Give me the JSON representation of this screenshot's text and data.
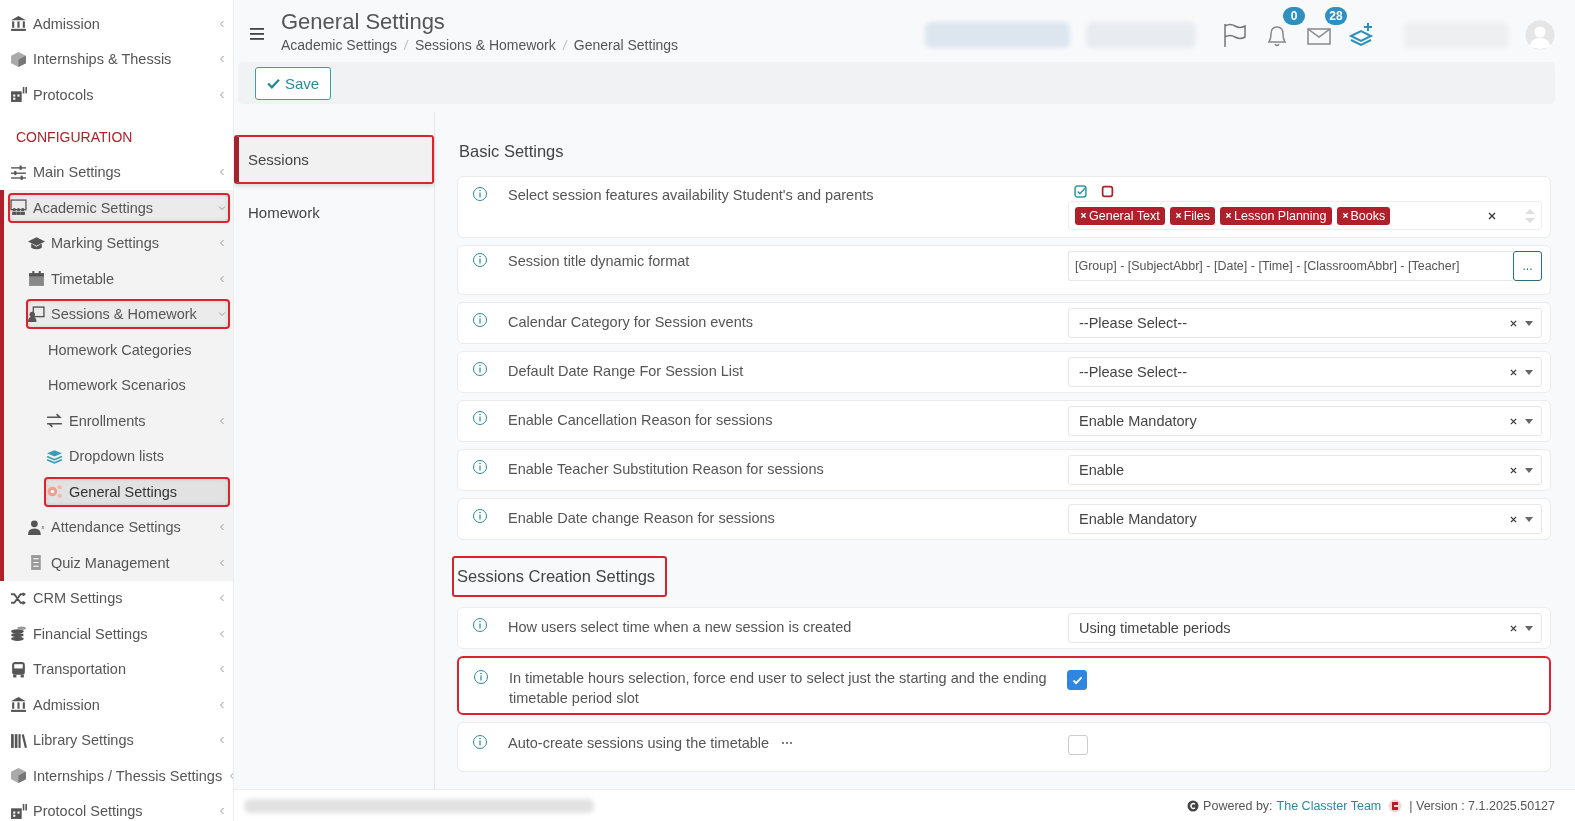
{
  "sidebar": {
    "items": [
      {
        "kind": "link",
        "label": "Admission",
        "expanded": false,
        "selected": false,
        "highlighted": false
      },
      {
        "kind": "link",
        "label": "Internships & Thessis",
        "expanded": false,
        "selected": false,
        "highlighted": false
      },
      {
        "kind": "link",
        "label": "Protocols",
        "expanded": false,
        "selected": false,
        "highlighted": false
      },
      {
        "kind": "heading",
        "label": "CONFIGURATION"
      },
      {
        "kind": "link",
        "label": "Main Settings",
        "expanded": false,
        "selected": false,
        "highlighted": false
      },
      {
        "kind": "link",
        "label": "Academic Settings",
        "expanded": true,
        "selected": false,
        "highlighted": true,
        "children": [
          {
            "kind": "link",
            "label": "Marking Settings",
            "expanded": false,
            "selected": false,
            "highlighted": false
          },
          {
            "kind": "link",
            "label": "Timetable",
            "expanded": false,
            "selected": false,
            "highlighted": false
          },
          {
            "kind": "link",
            "label": "Sessions & Homework",
            "expanded": true,
            "selected": false,
            "highlighted": true,
            "children": [
              {
                "kind": "link",
                "label": "Homework Categories",
                "selected": false,
                "highlighted": false
              },
              {
                "kind": "link",
                "label": "Homework Scenarios",
                "selected": false,
                "highlighted": false
              },
              {
                "kind": "link",
                "label": "Enrollments",
                "expanded": false,
                "selected": false,
                "highlighted": false
              },
              {
                "kind": "link",
                "label": "Dropdown lists",
                "selected": false,
                "highlighted": false
              },
              {
                "kind": "link",
                "label": "General Settings",
                "selected": true,
                "highlighted": true
              }
            ]
          },
          {
            "kind": "link",
            "label": "Attendance Settings",
            "expanded": false,
            "selected": false,
            "highlighted": false
          },
          {
            "kind": "link",
            "label": "Quiz Management",
            "expanded": false,
            "selected": false,
            "highlighted": false
          }
        ]
      },
      {
        "kind": "link",
        "label": "CRM Settings",
        "expanded": false,
        "selected": false,
        "highlighted": false
      },
      {
        "kind": "link",
        "label": "Financial Settings",
        "expanded": false,
        "selected": false,
        "highlighted": false
      },
      {
        "kind": "link",
        "label": "Transportation",
        "expanded": false,
        "selected": false,
        "highlighted": false
      },
      {
        "kind": "link",
        "label": "Admission",
        "expanded": false,
        "selected": false,
        "highlighted": false
      },
      {
        "kind": "link",
        "label": "Library Settings",
        "expanded": false,
        "selected": false,
        "highlighted": false
      },
      {
        "kind": "link",
        "label": "Internships / Thessis Settings",
        "expanded": false,
        "selected": false,
        "highlighted": false
      },
      {
        "kind": "link",
        "label": "Protocol Settings",
        "expanded": false,
        "selected": false,
        "highlighted": false
      }
    ]
  },
  "header": {
    "title": "General Settings",
    "breadcrumb": [
      "Academic Settings",
      "Sessions & Homework",
      "General Settings"
    ],
    "notifications": "0",
    "messages": "28"
  },
  "toolbar": {
    "save": "Save"
  },
  "tabs": [
    {
      "label": "Sessions",
      "selected": true,
      "highlighted": true
    },
    {
      "label": "Homework",
      "selected": false,
      "highlighted": false
    }
  ],
  "sections": [
    {
      "title": "Basic Settings",
      "highlighted": false,
      "rows": [
        {
          "kind": "tags",
          "label": "Select session features availability Student's and parents",
          "tags": [
            "General Text",
            "Files",
            "Lesson Planning",
            "Books"
          ],
          "highlighted": false
        },
        {
          "kind": "format",
          "label": "Session title dynamic format",
          "value": "[Group] - [SubjectAbbr] - [Date] - [Time] - [ClassroomAbbr] - [Teacher]",
          "button": "...",
          "highlighted": false
        },
        {
          "kind": "select",
          "label": "Calendar Category for Session events",
          "value": "--Please Select--",
          "highlighted": false
        },
        {
          "kind": "select",
          "label": "Default Date Range For Session List",
          "value": "--Please Select--",
          "highlighted": false
        },
        {
          "kind": "select",
          "label": "Enable Cancellation Reason for sessions",
          "value": "Enable Mandatory",
          "highlighted": false
        },
        {
          "kind": "select",
          "label": "Enable Teacher Substitution Reason for sessions",
          "value": "Enable",
          "highlighted": false
        },
        {
          "kind": "select",
          "label": "Enable Date change Reason for sessions",
          "value": "Enable Mandatory",
          "highlighted": false
        }
      ]
    },
    {
      "title": "Sessions Creation Settings",
      "highlighted": true,
      "rows": [
        {
          "kind": "select",
          "label": "How users select time when a new session is created",
          "value": "Using timetable periods",
          "highlighted": false
        },
        {
          "kind": "checkbox",
          "label": "In timetable hours selection, force end user to select just the starting and the ending timetable period slot",
          "checked": true,
          "has_menu": false,
          "highlighted": true
        },
        {
          "kind": "checkbox",
          "label": "Auto-create sessions using the timetable",
          "checked": false,
          "has_menu": true,
          "highlighted": false
        }
      ]
    }
  ],
  "footer": {
    "powered_by": "Powered by:",
    "link": "The Classter Team",
    "version": "| Version : 7.1.2025.50127"
  }
}
